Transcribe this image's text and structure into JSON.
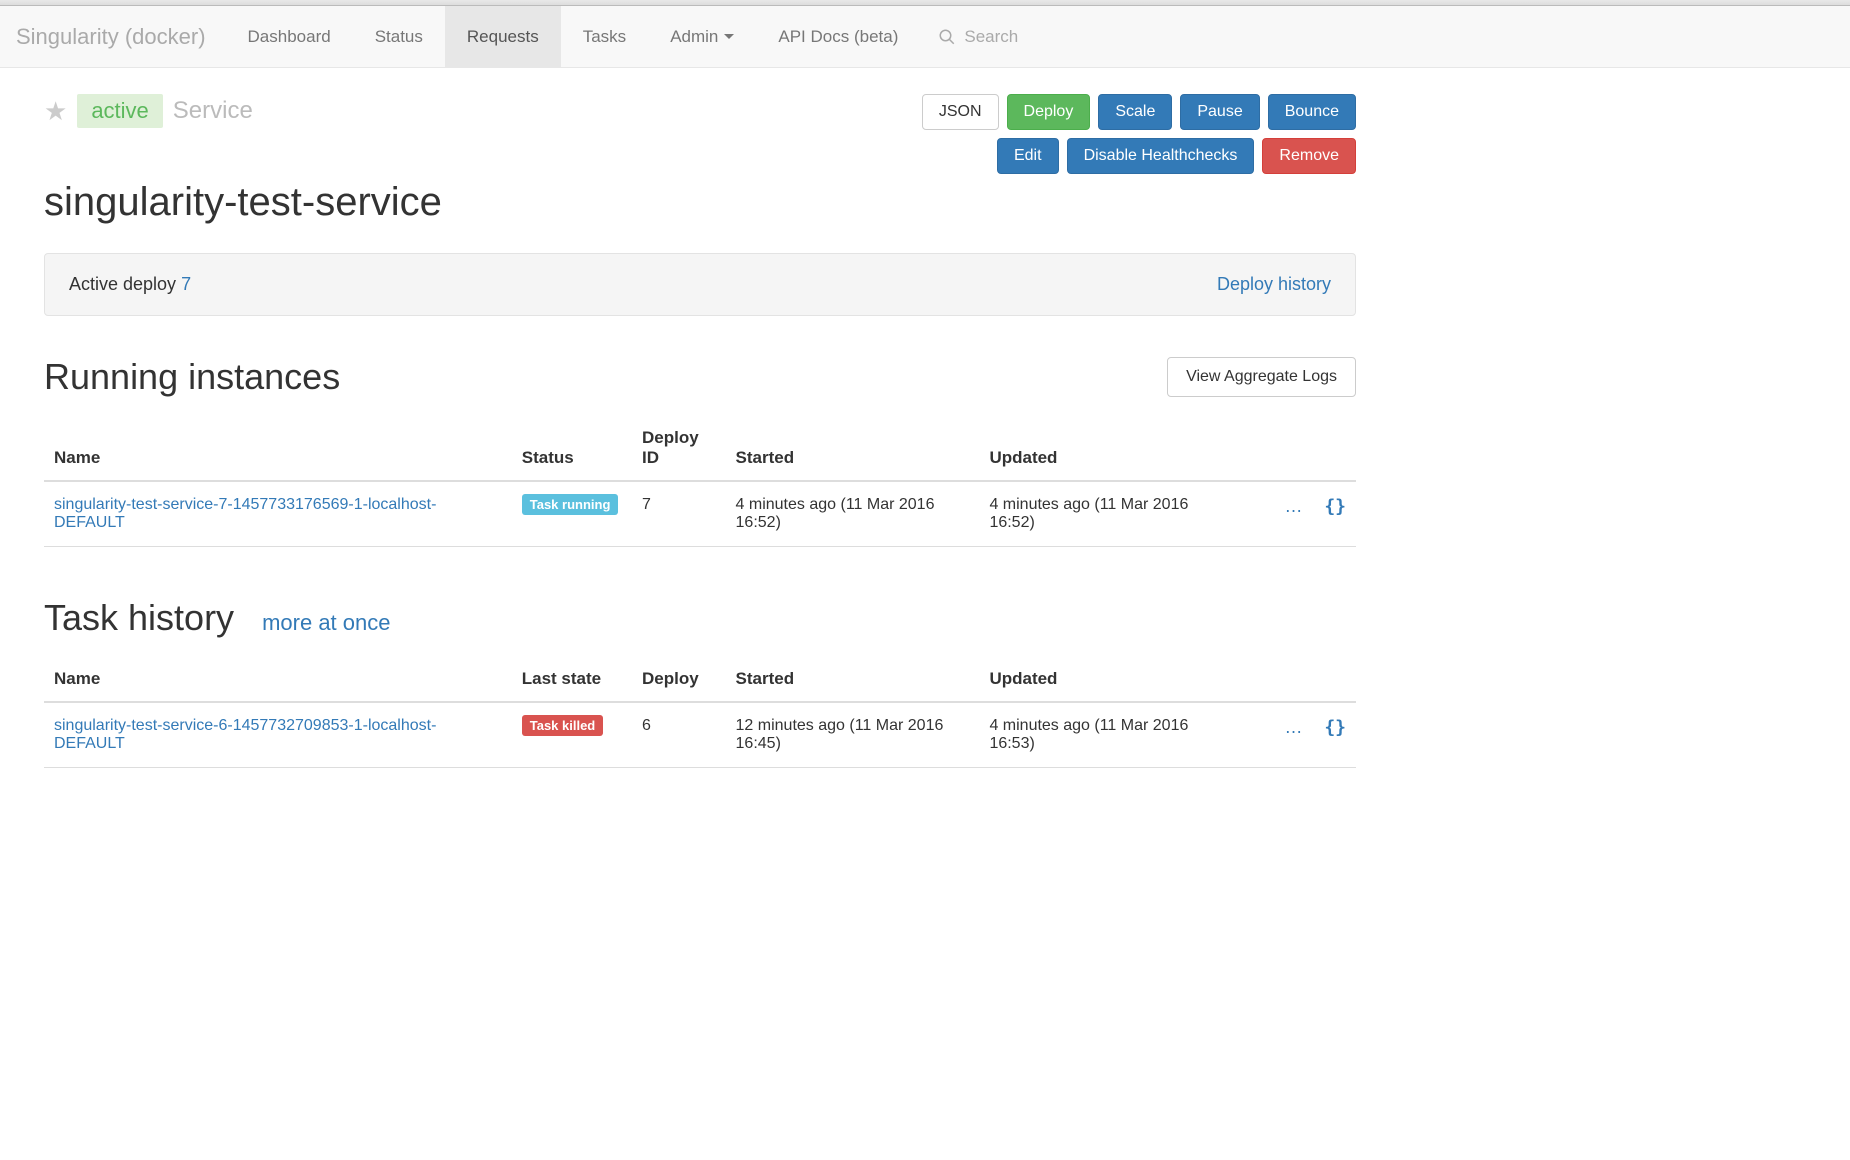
{
  "brand": "Singularity (docker)",
  "nav": {
    "items": [
      "Dashboard",
      "Status",
      "Requests",
      "Tasks",
      "Admin",
      "API Docs (beta)"
    ],
    "active_index": 2,
    "search_placeholder": "Search"
  },
  "header": {
    "state": "active",
    "type": "Service",
    "title": "singularity-test-service",
    "buttons_row1": [
      "JSON",
      "Deploy",
      "Scale",
      "Pause",
      "Bounce"
    ],
    "buttons_row2": [
      "Edit",
      "Disable Healthchecks",
      "Remove"
    ]
  },
  "deploy_well": {
    "label": "Active deploy",
    "id": "7",
    "history_link": "Deploy history"
  },
  "running": {
    "title": "Running instances",
    "view_logs": "View Aggregate Logs",
    "columns": [
      "Name",
      "Status",
      "Deploy ID",
      "Started",
      "Updated"
    ],
    "rows": [
      {
        "name": "singularity-test-service-7-1457733176569-1-localhost-DEFAULT",
        "status": "Task running",
        "status_class": "info",
        "deploy_id": "7",
        "started": "4 minutes ago (11 Mar 2016 16:52)",
        "updated": "4 minutes ago (11 Mar 2016 16:52)"
      }
    ]
  },
  "history": {
    "title": "Task history",
    "more_link": "more at once",
    "columns": [
      "Name",
      "Last state",
      "Deploy",
      "Started",
      "Updated"
    ],
    "rows": [
      {
        "name": "singularity-test-service-6-1457732709853-1-localhost-DEFAULT",
        "status": "Task killed",
        "status_class": "danger",
        "deploy_id": "6",
        "started": "12 minutes ago (11 Mar 2016 16:45)",
        "updated": "4 minutes ago (11 Mar 2016 16:53)"
      }
    ]
  }
}
